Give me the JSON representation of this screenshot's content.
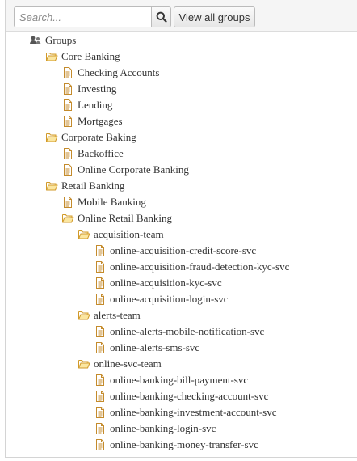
{
  "toolbar": {
    "search_placeholder": "Search...",
    "view_all_label": "View all groups"
  },
  "tree": {
    "root_label": "Groups",
    "groups": [
      {
        "label": "Core Banking",
        "children": [
          "Checking Accounts",
          "Investing",
          "Lending",
          "Mortgages"
        ]
      },
      {
        "label": "Corporate Baking",
        "children": [
          "Backoffice",
          "Online Corporate Banking"
        ]
      },
      {
        "label": "Retail Banking",
        "leaf": "Mobile Banking",
        "sub": {
          "label": "Online Retail Banking",
          "teams": [
            {
              "label": "acquisition-team",
              "children": [
                "online-acquisition-credit-score-svc",
                "online-acquisition-fraud-detection-kyc-svc",
                "online-acquisition-kyc-svc",
                "online-acquisition-login-svc"
              ]
            },
            {
              "label": "alerts-team",
              "children": [
                "online-alerts-mobile-notification-svc",
                "online-alerts-sms-svc"
              ]
            },
            {
              "label": "online-svc-team",
              "children": [
                "online-banking-bill-payment-svc",
                "online-banking-checking-account-svc",
                "online-banking-investment-account-svc",
                "online-banking-login-svc",
                "online-banking-money-transfer-svc"
              ]
            }
          ]
        }
      }
    ]
  },
  "colors": {
    "folder_fill": "#fbe6a0",
    "folder_stroke": "#d19a2a",
    "doc_stroke": "#c48b2c",
    "text": "#333333"
  }
}
